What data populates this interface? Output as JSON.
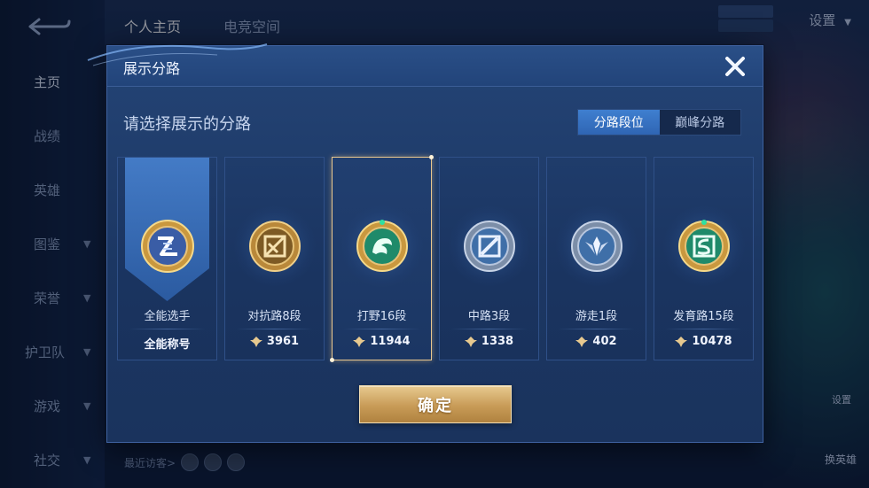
{
  "background": {
    "top_tabs": [
      "个人主页",
      "电竞空间"
    ],
    "settings_label": "设置",
    "nav_items": [
      {
        "label": "主页",
        "has_chevron": false
      },
      {
        "label": "战绩",
        "has_chevron": false
      },
      {
        "label": "英雄",
        "has_chevron": false
      },
      {
        "label": "图鉴",
        "has_chevron": true
      },
      {
        "label": "荣誉",
        "has_chevron": true
      },
      {
        "label": "护卫队",
        "has_chevron": true
      },
      {
        "label": "游戏",
        "has_chevron": true
      },
      {
        "label": "社交",
        "has_chevron": true
      }
    ],
    "recent_visitors_label": "最近访客>",
    "right_mid_label": "设置",
    "right_bottom_label": "换英雄"
  },
  "dialog": {
    "title": "展示分路",
    "prompt": "请选择展示的分路",
    "toggle": {
      "options": [
        "分路段位",
        "巅峰分路"
      ],
      "active_index": 0
    },
    "cards": [
      {
        "name": "全能选手",
        "value": "全能称号",
        "has_gem": false,
        "selected": false,
        "emblem": "all-round-emblem-icon",
        "emblem_color": "#d9a645"
      },
      {
        "name": "对抗路8段",
        "value": "3961",
        "has_gem": true,
        "selected": false,
        "emblem": "clash-lane-emblem-icon",
        "emblem_color": "#c99a3f"
      },
      {
        "name": "打野16段",
        "value": "11944",
        "has_gem": true,
        "selected": true,
        "emblem": "jungle-emblem-icon",
        "emblem_color": "#2fae8a"
      },
      {
        "name": "中路3段",
        "value": "1338",
        "has_gem": true,
        "selected": false,
        "emblem": "mid-lane-emblem-icon",
        "emblem_color": "#8a9bb4"
      },
      {
        "name": "游走1段",
        "value": "402",
        "has_gem": true,
        "selected": false,
        "emblem": "roam-emblem-icon",
        "emblem_color": "#8a9bb4"
      },
      {
        "name": "发育路15段",
        "value": "10478",
        "has_gem": true,
        "selected": false,
        "emblem": "farm-lane-emblem-icon",
        "emblem_color": "#2fae8a"
      }
    ],
    "confirm_label": "确定"
  },
  "colors": {
    "gold": "#e7c98f",
    "dialog_bg": "#244476",
    "toggle_active": "#3f7fd0"
  }
}
